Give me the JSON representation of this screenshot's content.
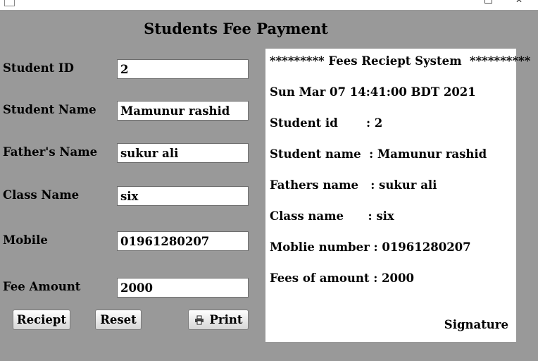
{
  "window": {
    "title": "Students Fee Payment",
    "icons": {
      "app": "app-icon",
      "maximize": "maximize-icon",
      "close": "close-icon"
    },
    "close_glyph": "✕"
  },
  "form": {
    "fields": [
      {
        "label": "Student ID",
        "value": "2"
      },
      {
        "label": "Student Name",
        "value": "Mamunur rashid"
      },
      {
        "label": "Father's Name",
        "value": "sukur ali"
      },
      {
        "label": "Class Name",
        "value": "six"
      },
      {
        "label": "Mobile",
        "value": "01961280207"
      },
      {
        "label": "Fee Amount",
        "value": "2000"
      }
    ]
  },
  "buttons": {
    "receipt": "Reciept",
    "reset": "Reset",
    "print": "Print",
    "print_icon": "printer-icon"
  },
  "receipt": {
    "header": "********* Fees Reciept System  **********",
    "date": "Sun Mar 07 14:41:00 BDT 2021",
    "lines": [
      "Student id       : 2",
      "Student name  : Mamunur rashid",
      "Fathers name   : sukur ali",
      "Class name      : six",
      "Moblie number : 01961280207",
      "Fees of amount : 2000"
    ],
    "signature": "Signature"
  },
  "colors": {
    "background": "#999999",
    "panel": "#ffffff",
    "text": "#000000"
  }
}
